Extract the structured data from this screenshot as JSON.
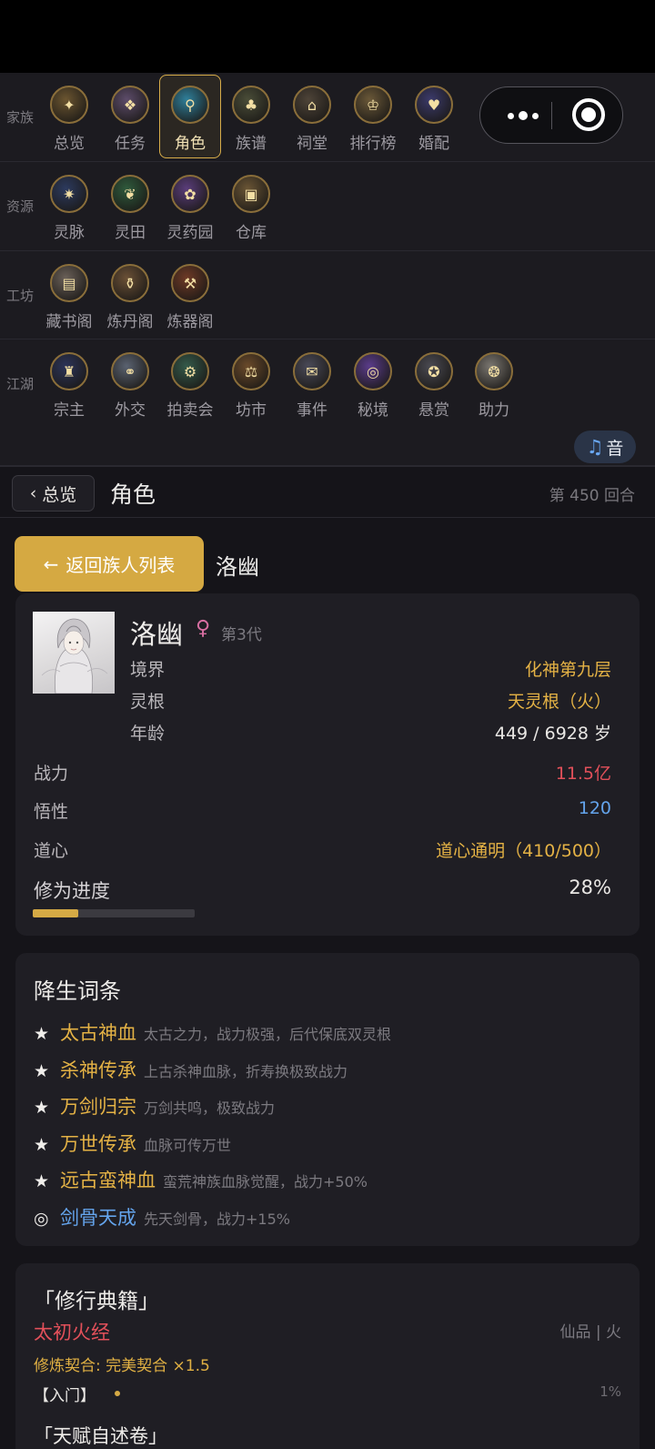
{
  "nav": {
    "sections": [
      {
        "category": "家族",
        "items": [
          {
            "label": "总览",
            "icon": "overview-icon",
            "glyph": "✦",
            "color": "#6b5530"
          },
          {
            "label": "任务",
            "icon": "scroll-icon",
            "glyph": "❖",
            "color": "#5d4c6a"
          },
          {
            "label": "角色",
            "icon": "character-icon",
            "glyph": "⚲",
            "color": "#2f7f9a",
            "active": true
          },
          {
            "label": "族谱",
            "icon": "family-tree-icon",
            "glyph": "♣",
            "color": "#4a4d38"
          },
          {
            "label": "祠堂",
            "icon": "ancestral-hall-icon",
            "glyph": "⌂",
            "color": "#4e4438"
          },
          {
            "label": "排行榜",
            "icon": "ranking-icon",
            "glyph": "♔",
            "color": "#6a5838"
          },
          {
            "label": "婚配",
            "icon": "marriage-icon",
            "glyph": "♥",
            "color": "#3b3a6a"
          }
        ]
      },
      {
        "category": "资源",
        "items": [
          {
            "label": "灵脉",
            "icon": "spirit-vein-icon",
            "glyph": "✷",
            "color": "#2c3a5e"
          },
          {
            "label": "灵田",
            "icon": "spirit-field-icon",
            "glyph": "❦",
            "color": "#2f5a3c"
          },
          {
            "label": "灵药园",
            "icon": "herb-garden-icon",
            "glyph": "✿",
            "color": "#5a3d7a"
          },
          {
            "label": "仓库",
            "icon": "warehouse-icon",
            "glyph": "▣",
            "color": "#6a5535"
          }
        ]
      },
      {
        "category": "工坊",
        "items": [
          {
            "label": "藏书阁",
            "icon": "library-icon",
            "glyph": "▤",
            "color": "#6a6058"
          },
          {
            "label": "炼丹阁",
            "icon": "alchemy-icon",
            "glyph": "⚱",
            "color": "#6a5036"
          },
          {
            "label": "炼器阁",
            "icon": "forge-icon",
            "glyph": "⚒",
            "color": "#6e3a26"
          }
        ]
      },
      {
        "category": "江湖",
        "items": [
          {
            "label": "宗主",
            "icon": "sect-master-icon",
            "glyph": "♜",
            "color": "#2c3458"
          },
          {
            "label": "外交",
            "icon": "diplomacy-icon",
            "glyph": "⚭",
            "color": "#5a6270"
          },
          {
            "label": "拍卖会",
            "icon": "auction-icon",
            "glyph": "⚙",
            "color": "#345a4a"
          },
          {
            "label": "坊市",
            "icon": "market-icon",
            "glyph": "⚖",
            "color": "#6a4a2a"
          },
          {
            "label": "事件",
            "icon": "event-icon",
            "glyph": "✉",
            "color": "#4a4a58"
          },
          {
            "label": "秘境",
            "icon": "secret-realm-icon",
            "glyph": "◎",
            "color": "#5a3c8a"
          },
          {
            "label": "悬赏",
            "icon": "bounty-icon",
            "glyph": "✪",
            "color": "#4a4a52"
          },
          {
            "label": "助力",
            "icon": "assist-icon",
            "glyph": "❂",
            "color": "#7a7670"
          }
        ]
      }
    ]
  },
  "music": {
    "icon": "music-note-icon",
    "label": "音"
  },
  "header": {
    "back_label": "总览",
    "title": "角色",
    "round": "第 450 回合"
  },
  "return_button": "返回族人列表",
  "character_name": "洛幽",
  "profile": {
    "name": "洛幽",
    "gender_symbol": "♀",
    "generation": "第3代",
    "realm_label": "境界",
    "realm": "化神第九层",
    "root_label": "灵根",
    "root": "天灵根（火）",
    "age_label": "年龄",
    "age": "449 / 6928 岁",
    "power_label": "战力",
    "power": "11.5亿",
    "insight_label": "悟性",
    "insight": "120",
    "dao_label": "道心",
    "dao": "道心通明（410/500）",
    "progress_label": "修为进度",
    "progress": "28%",
    "progress_value": 0.28
  },
  "traits": {
    "title": "降生词条",
    "items": [
      {
        "mark": "★",
        "name": "太古神血",
        "desc": "太古之力，战力极强，后代保底双灵根",
        "color": "#e4b245"
      },
      {
        "mark": "★",
        "name": "杀神传承",
        "desc": "上古杀神血脉，折寿换极致战力",
        "color": "#e4b245"
      },
      {
        "mark": "★",
        "name": "万剑归宗",
        "desc": "万剑共鸣，极致战力",
        "color": "#e4b245"
      },
      {
        "mark": "★",
        "name": "万世传承",
        "desc": "血脉可传万世",
        "color": "#e4b245"
      },
      {
        "mark": "★",
        "name": "远古蛮神血",
        "desc": "蛮荒神族血脉觉醒，战力+50%",
        "color": "#e4b245"
      },
      {
        "mark": "◎",
        "name": "剑骨天成",
        "desc": "先天剑骨，战力+15%",
        "color": "#64a4ec"
      }
    ]
  },
  "skills": {
    "title": "「修行典籍」",
    "name": "太初火经",
    "tag": "仙品 | 火",
    "fit": "修炼契合: 完美契合 ×1.5",
    "level": "【入门】",
    "percent": "1%",
    "next_title": "「天赋自述卷」"
  }
}
